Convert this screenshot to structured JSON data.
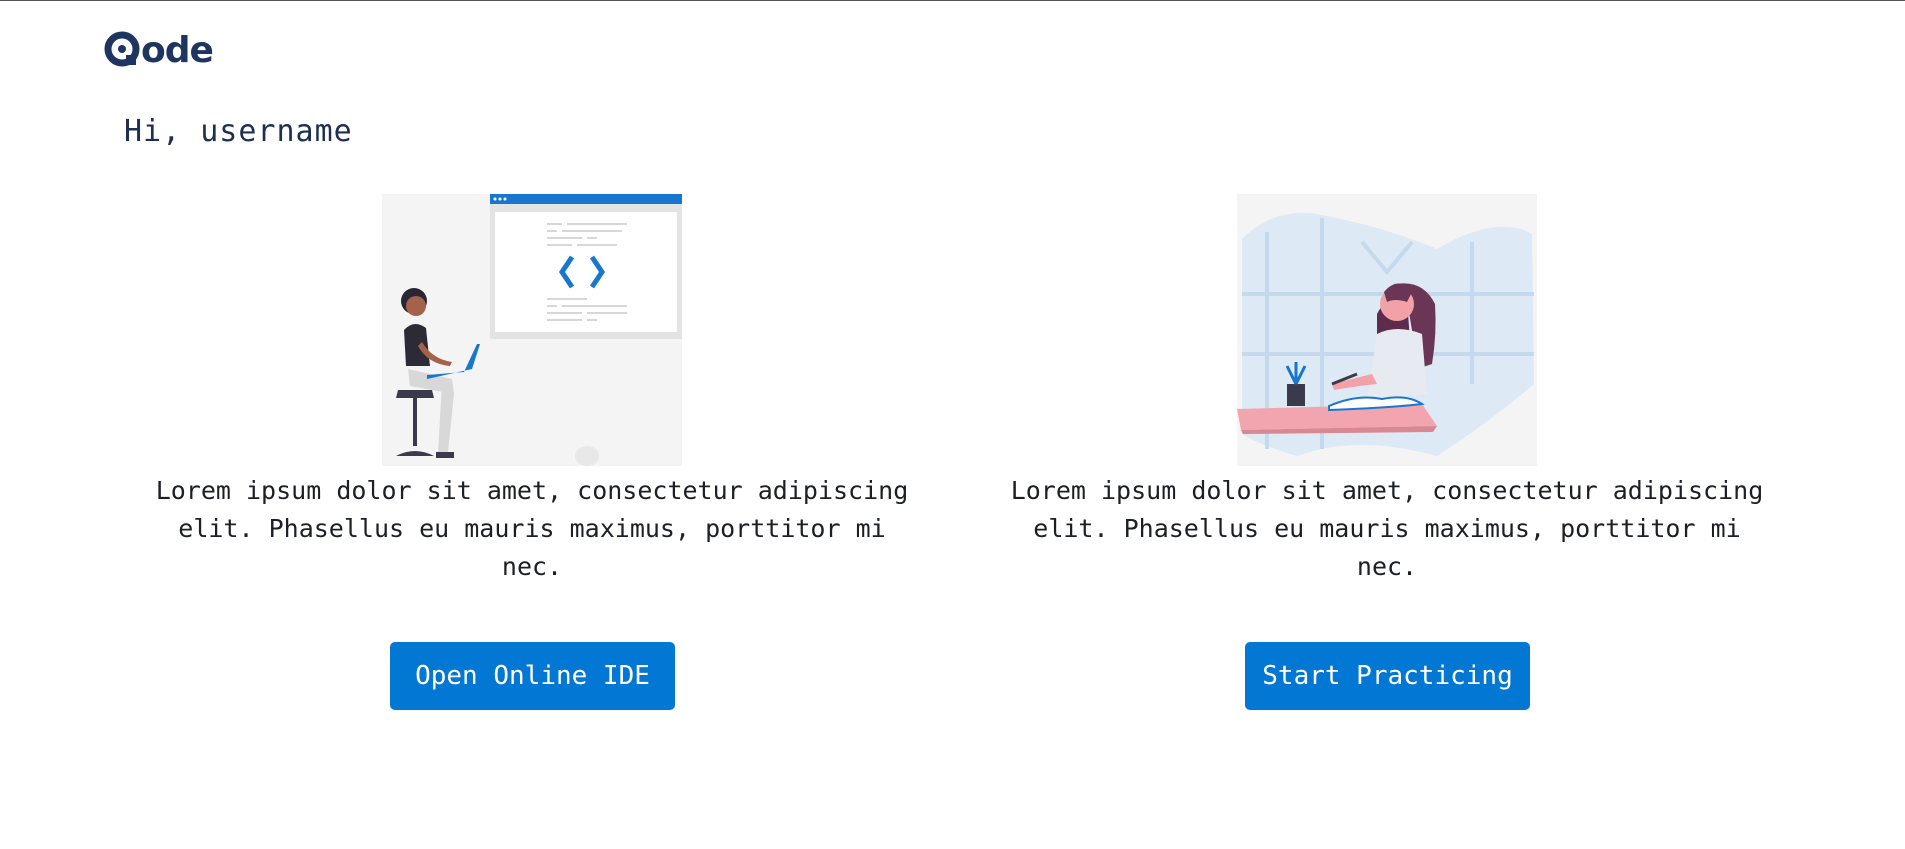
{
  "brand": {
    "name": "ode",
    "logo_icon": "q-logo-icon"
  },
  "greeting": "Hi, username",
  "cards": [
    {
      "illustration": "developer-at-screen-illustration",
      "description": "Lorem ipsum dolor sit amet, consectetur adipiscing elit. Phasellus eu mauris maximus, porttitor mi nec.",
      "button_label": "Open Online IDE"
    },
    {
      "illustration": "woman-studying-illustration",
      "description": "Lorem ipsum dolor sit amet, consectetur adipiscing elit. Phasellus eu mauris maximus, porttitor mi nec.",
      "button_label": "Start Practicing"
    }
  ],
  "colors": {
    "brand_navy": "#1f3561",
    "primary_button": "#0278d4",
    "accent_pink": "#f29aa5"
  }
}
